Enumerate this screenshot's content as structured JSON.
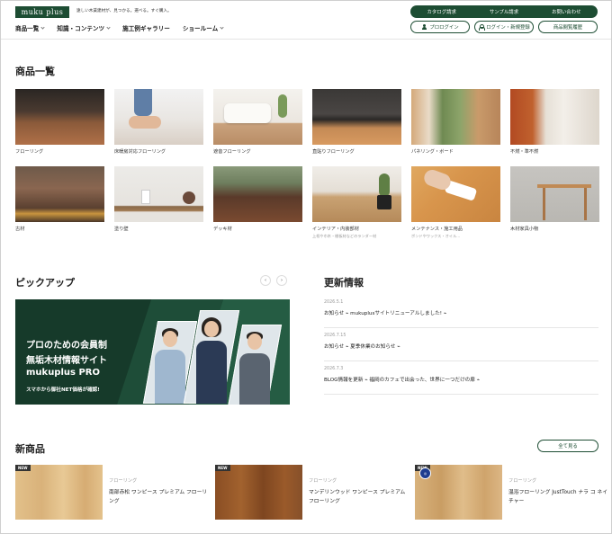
{
  "header": {
    "logo": "muku plus",
    "tagline": "遠しい木賃建材が、見つかる。選べる。すぐ購入。",
    "top_links": [
      "カタログ請求",
      "サンプル請求",
      "お問い合わせ"
    ],
    "nav": [
      "商品一覧",
      "知識・コンテンツ",
      "施工例ギャラリー",
      "ショールーム"
    ],
    "buttons": {
      "pro_login": "プロログイン",
      "login_register": "ログイン・新規登録",
      "history": "商品閲覧履歴"
    }
  },
  "products_section": {
    "title": "商品一覧",
    "items": [
      {
        "label": "フローリング"
      },
      {
        "label": "床暖房対応フローリング"
      },
      {
        "label": "遮音フローリング"
      },
      {
        "label": "直貼りフローリング"
      },
      {
        "label": "パネリング・ボード"
      },
      {
        "label": "不燃・準不燃"
      },
      {
        "label": "古材"
      },
      {
        "label": "塗り壁"
      },
      {
        "label": "デッキ材"
      },
      {
        "label": "インテリア・内装部材",
        "sub": "上框や巾木・棚板材などのランダー材"
      },
      {
        "label": "メンテナンス・施工用品",
        "sub": "ボンドやワックス・オイル..."
      },
      {
        "label": "木材家具小物"
      }
    ]
  },
  "pickup": {
    "title": "ピックアップ",
    "prev": "‹",
    "next": "›",
    "banner": {
      "line1": "プロのための会員制",
      "line2": "無垢木材情報サイト",
      "line3": "mukuplus PRO",
      "line4": "スマホから御社NET価格が確認!"
    }
  },
  "news": {
    "title": "更新情報",
    "items": [
      {
        "date": "2026.5.1",
        "text": "お知らせ ⌁ mukuplusサイトリニューアルしました! ⌁"
      },
      {
        "date": "2026.7.15",
        "text": "お知らせ ⌁ 夏季休業のお知らせ ⌁"
      },
      {
        "date": "2026.7.3",
        "text": "BLOG情報を更新 ⌁ 福岡のカフェで出会った、世界に一つだけの扉 ⌁"
      }
    ]
  },
  "new_products": {
    "title": "新商品",
    "see_all": "全て見る",
    "items": [
      {
        "tag": "NEW",
        "category": "フローリング",
        "name": "南部赤松 ワンピース プレミアム フローリング"
      },
      {
        "tag": "NEW",
        "category": "フローリング",
        "name": "マンデリンウッド ワンピース プレミアム フローリング"
      },
      {
        "tag": "NEW",
        "category": "フローリング",
        "name": "温浴フローリング JustTouch ナラ コ ネイチャー"
      }
    ]
  },
  "colors": {
    "brand": "#1d4d33"
  }
}
